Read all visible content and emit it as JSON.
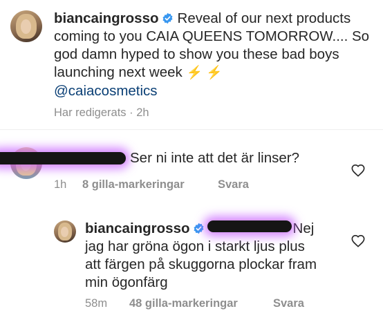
{
  "post": {
    "username": "biancaingrosso",
    "caption_text": "Reveal of our next products coming to you CAIA QUEENS TOMORROW.... So god damn hyped to show you these bad boys launching next week",
    "emojis": "⚡ ⚡",
    "mention": "@caiacosmetics",
    "edited_label": "Har redigerats",
    "separator": "·",
    "time": "2h"
  },
  "comments": [
    {
      "username": "[redacted]",
      "text": "Ser ni inte att det är linser?",
      "time": "1h",
      "likes": "8 gilla-markeringar",
      "reply_label": "Svara"
    },
    {
      "username": "biancaingrosso",
      "mention": "[redacted]",
      "text": "Nej jag har gröna ögon i starkt ljus plus att färgen på skuggorna plockar fram min ögonfärg",
      "time": "58m",
      "likes": "48 gilla-markeringar",
      "reply_label": "Svara"
    }
  ],
  "icons": {
    "verified": "verified-badge-icon",
    "like": "heart-icon"
  },
  "colors": {
    "text": "#262626",
    "meta": "#8e8e8e",
    "verified": "#3897f0",
    "mention": "#0a3f75",
    "redaction_glow": "#c45aff"
  }
}
